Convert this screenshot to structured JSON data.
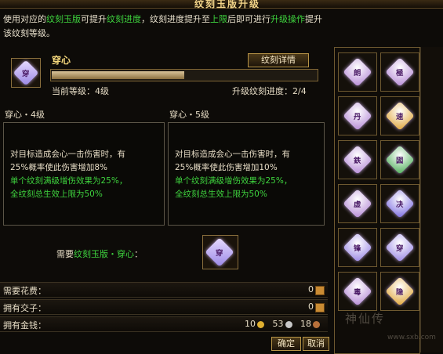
{
  "window": {
    "title": "纹刻玉版升级"
  },
  "instruction": {
    "t1": "使用对应的",
    "t2": "纹刻玉版",
    "t3": "可提升",
    "t4": "纹刻进度",
    "t5": "，纹刻进度提升至",
    "t6": "上限",
    "t7": "后即可进行",
    "t8": "升级操作",
    "t9": "提升该纹刻等级。"
  },
  "skill": {
    "name": "穿心",
    "icon_char": "穿",
    "detail_button": "纹刻详情",
    "progress_fraction": 0.5,
    "current_level": "当前等级：4级",
    "upgrade_progress": "升级纹刻进度：2/4"
  },
  "levels": [
    {
      "header": "穿心・4级",
      "line1": "对目标造成会心一击伤害时，有",
      "line2": "25%概率使此伤害增加8%",
      "line3": "单个纹刻满级增伤效果为25%，",
      "line4": "全纹刻总生效上限为50%"
    },
    {
      "header": "穿心・5级",
      "line1": "对目标造成会心一击伤害时，有",
      "line2": "25%概率使此伤害增加10%",
      "line3": "单个纹刻满级增伤效果为25%，",
      "line4": "全纹刻总生效上限为50%"
    }
  ],
  "requirement": {
    "prefix": "需要",
    "item": "纹刻玉版・穿心",
    "suffix": "："
  },
  "costs": {
    "fee_label": "需要花费：",
    "fee_value": "0",
    "jiaozi_label": "拥有交子：",
    "jiaozi_value": "0",
    "money_label": "拥有金钱：",
    "gold": "10",
    "silver": "53",
    "copper": "18"
  },
  "buttons": {
    "confirm": "确定",
    "cancel": "取消"
  },
  "gems": [
    {
      "char": "朗",
      "color": "#b58ad6"
    },
    {
      "char": "極",
      "color": "#b58ad6"
    },
    {
      "char": "丹",
      "color": "#b58ad6"
    },
    {
      "char": "速",
      "color": "#e0a63a"
    },
    {
      "char": "鉄",
      "color": "#b58ad6"
    },
    {
      "char": "図",
      "color": "#4fae5a"
    },
    {
      "char": "虚",
      "color": "#b58ad6"
    },
    {
      "char": "决",
      "color": "#7b6be0"
    },
    {
      "char": "锋",
      "color": "#9a87e6"
    },
    {
      "char": "穿",
      "color": "#9a87e6"
    },
    {
      "char": "毒",
      "color": "#b58ad6"
    },
    {
      "char": "隐",
      "color": "#e0a63a"
    }
  ],
  "watermark": {
    "text": "神仙传",
    "url": "www.sxb.com"
  }
}
